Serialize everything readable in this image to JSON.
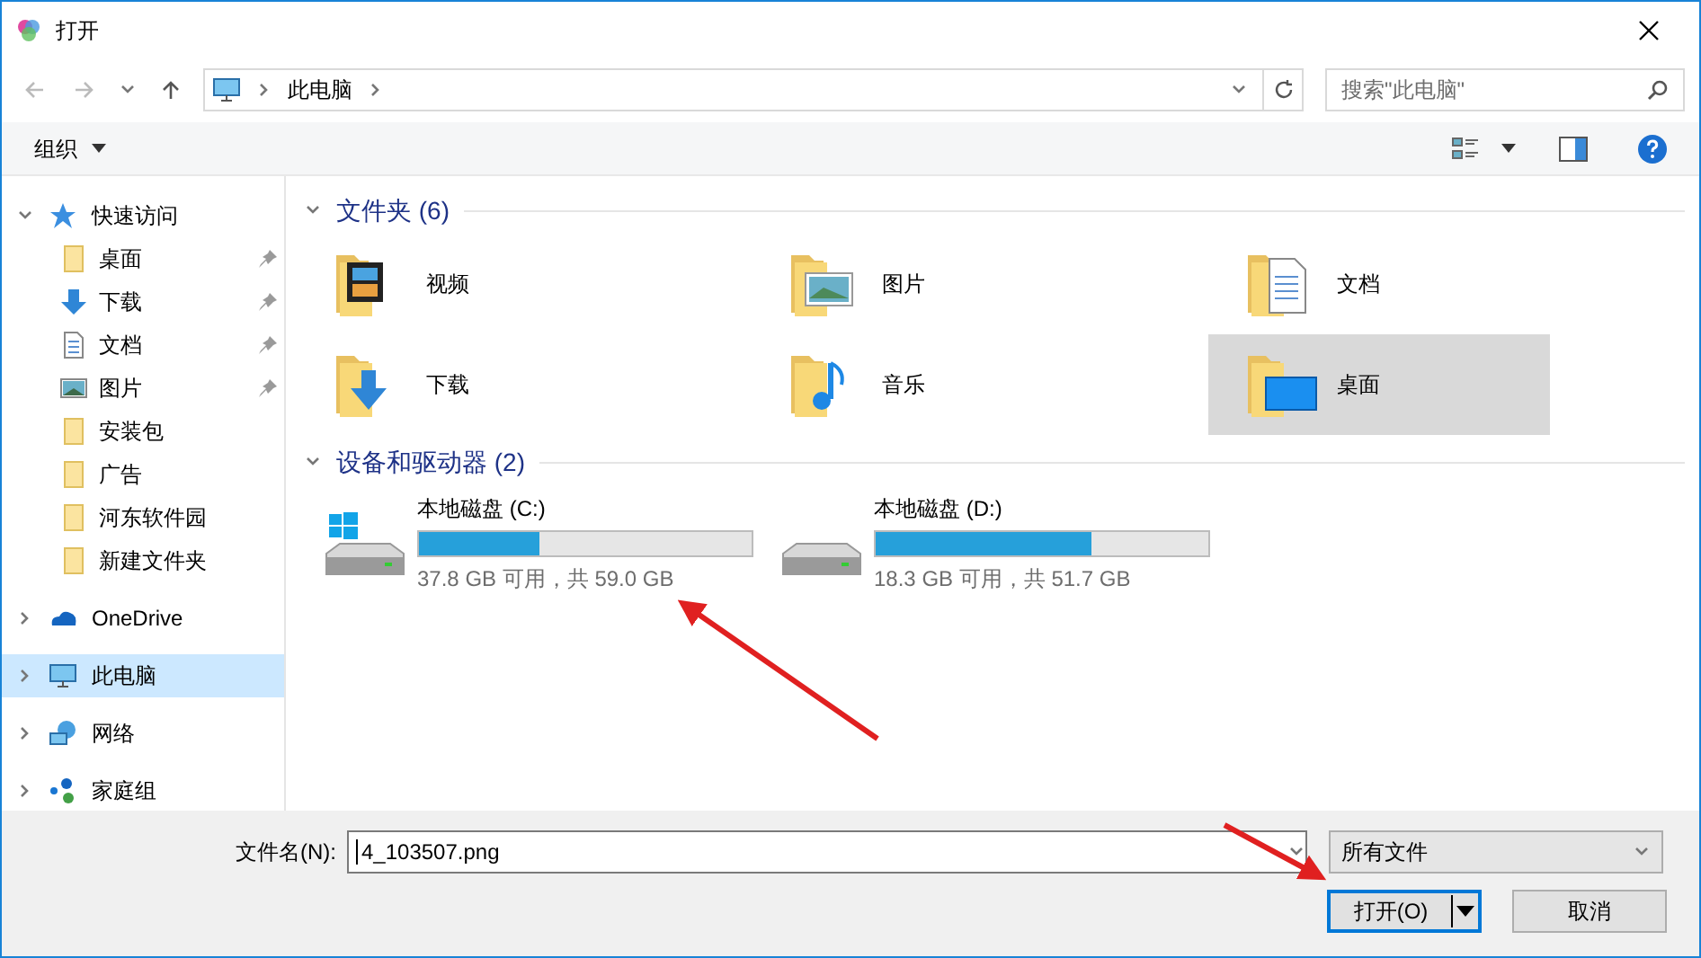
{
  "window": {
    "title": "打开"
  },
  "address": {
    "path": [
      "此电脑"
    ],
    "search_placeholder": "搜索\"此电脑\""
  },
  "toolbar": {
    "organize": "组织"
  },
  "nav": [
    {
      "label": "快速访问",
      "kind": "star",
      "expanded": true,
      "selected": false,
      "children": [
        {
          "label": "桌面",
          "kind": "folder",
          "pinned": true
        },
        {
          "label": "下载",
          "kind": "download",
          "pinned": true
        },
        {
          "label": "文档",
          "kind": "doc",
          "pinned": true
        },
        {
          "label": "图片",
          "kind": "picture",
          "pinned": true
        },
        {
          "label": "安装包",
          "kind": "folder",
          "pinned": false
        },
        {
          "label": "广告",
          "kind": "folder",
          "pinned": false
        },
        {
          "label": "河东软件园",
          "kind": "folder",
          "pinned": false
        },
        {
          "label": "新建文件夹",
          "kind": "folder",
          "pinned": false
        }
      ]
    },
    {
      "label": "OneDrive",
      "kind": "cloud",
      "expanded": false,
      "selected": false
    },
    {
      "label": "此电脑",
      "kind": "pc",
      "expanded": false,
      "selected": true
    },
    {
      "label": "网络",
      "kind": "network",
      "expanded": false,
      "selected": false
    },
    {
      "label": "家庭组",
      "kind": "homegroup",
      "expanded": false,
      "selected": false
    }
  ],
  "folders": {
    "heading": "文件夹 (6)",
    "items": [
      {
        "label": "视频",
        "kind": "video",
        "selected": false
      },
      {
        "label": "图片",
        "kind": "picture",
        "selected": false
      },
      {
        "label": "文档",
        "kind": "doc",
        "selected": false
      },
      {
        "label": "下载",
        "kind": "download",
        "selected": false
      },
      {
        "label": "音乐",
        "kind": "music",
        "selected": false
      },
      {
        "label": "桌面",
        "kind": "desktop",
        "selected": true
      }
    ]
  },
  "drives": {
    "heading": "设备和驱动器 (2)",
    "items": [
      {
        "name": "本地磁盘 (C:)",
        "system": true,
        "level": 0.36,
        "reading": "37.8 GB 可用，共 59.0 GB"
      },
      {
        "name": "本地磁盘 (D:)",
        "system": false,
        "level": 0.65,
        "reading": "18.3 GB 可用，共 51.7 GB"
      }
    ]
  },
  "footer": {
    "filename_label": "文件名(N):",
    "filename": "4_103507.png",
    "filter": "所有文件",
    "open": "打开(O)",
    "cancel": "取消"
  }
}
